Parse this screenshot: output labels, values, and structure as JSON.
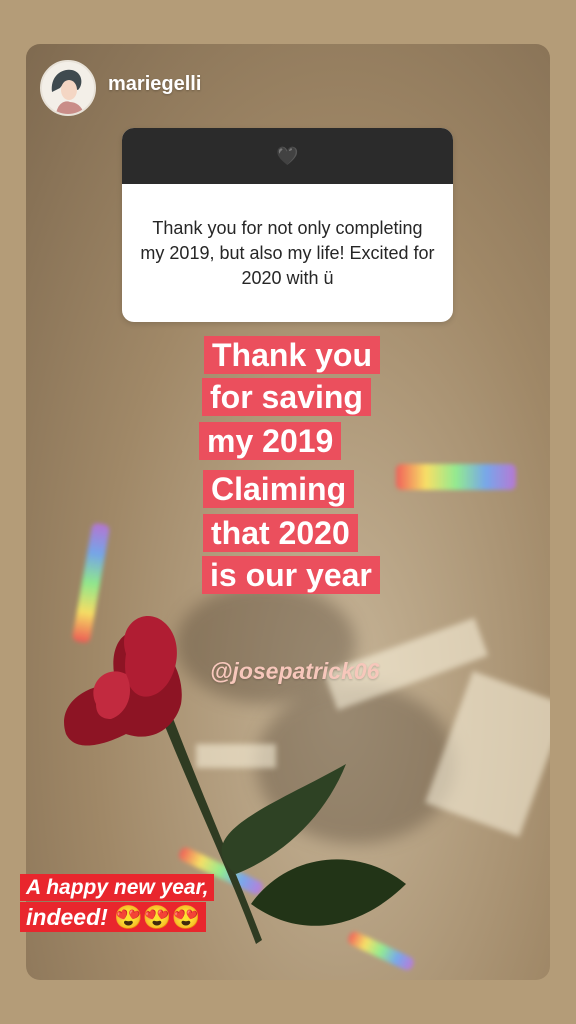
{
  "header": {
    "username": "mariegelli",
    "avatar_icon": "avatar-illustration-icon"
  },
  "question_card": {
    "header_icon": "black-heart-icon",
    "header_glyph": "🖤",
    "text": "Thank you for not only completing my 2019, but also my life! Excited for 2020 with ü"
  },
  "caption": {
    "lines": [
      "Thank you",
      "for saving",
      "my 2019",
      "Claiming",
      "that 2020",
      "is our year"
    ],
    "color": "#eb4f5d"
  },
  "mention": "@josepatrick06",
  "bottom_text": {
    "line1": "A happy new year,",
    "line2": "indeed!",
    "emojis": "😍😍😍",
    "color": "#e9262d"
  }
}
